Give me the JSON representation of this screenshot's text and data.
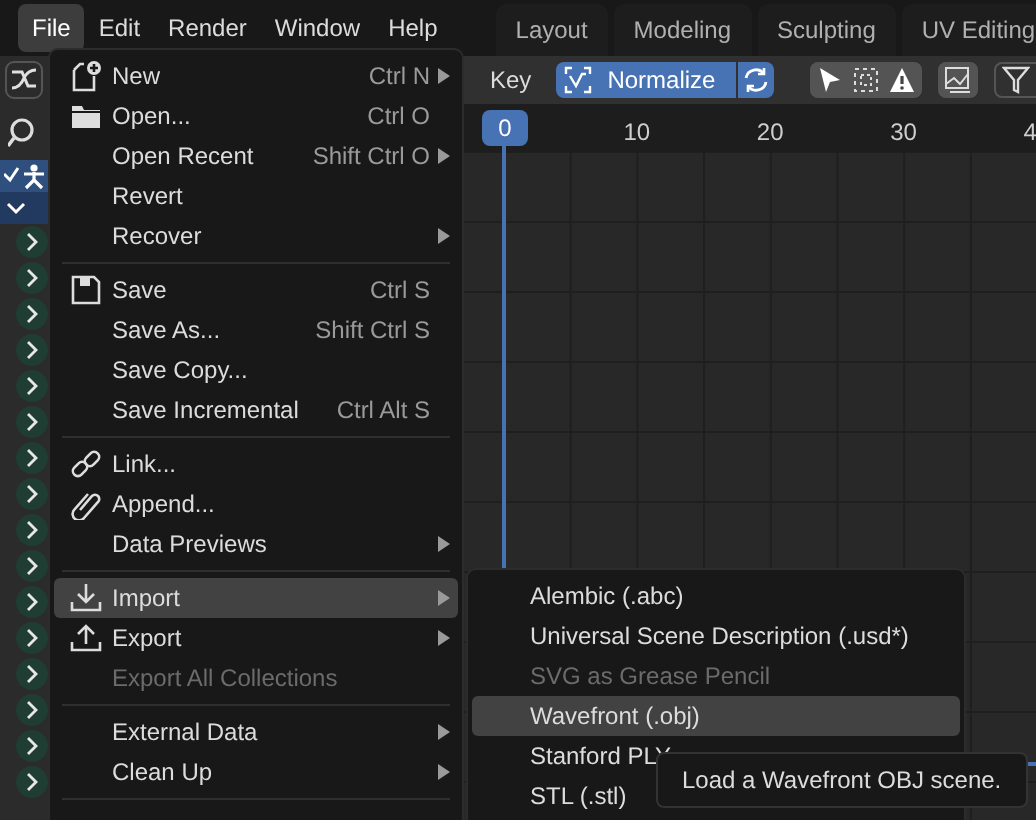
{
  "menubar": [
    {
      "label": "File",
      "selected": true
    },
    {
      "label": "Edit",
      "selected": false
    },
    {
      "label": "Render",
      "selected": false
    },
    {
      "label": "Window",
      "selected": false
    },
    {
      "label": "Help",
      "selected": false
    }
  ],
  "workspaces": [
    "Layout",
    "Modeling",
    "Sculpting",
    "UV Editing"
  ],
  "timeline": {
    "header_label": "Key",
    "normalize": {
      "label": "Normalize",
      "on": true
    },
    "current_frame": "0",
    "ticks": [
      "10",
      "20",
      "30",
      "4"
    ]
  },
  "file_menu": [
    {
      "kind": "item",
      "label": "New",
      "shortcut": "Ctrl N",
      "submenu": true,
      "disabled": false,
      "selected": false
    },
    {
      "kind": "item",
      "label": "Open...",
      "shortcut": "Ctrl O",
      "submenu": false,
      "disabled": false,
      "selected": false
    },
    {
      "kind": "item",
      "label": "Open Recent",
      "shortcut": "Shift Ctrl O",
      "submenu": true,
      "disabled": false,
      "selected": false
    },
    {
      "kind": "item",
      "label": "Revert",
      "submenu": false,
      "disabled": false,
      "selected": false
    },
    {
      "kind": "item",
      "label": "Recover",
      "submenu": true,
      "disabled": false,
      "selected": false
    },
    {
      "kind": "separator"
    },
    {
      "kind": "item",
      "label": "Save",
      "shortcut": "Ctrl S",
      "submenu": false,
      "disabled": false,
      "selected": false
    },
    {
      "kind": "item",
      "label": "Save As...",
      "shortcut": "Shift Ctrl S",
      "submenu": false,
      "disabled": false,
      "selected": false
    },
    {
      "kind": "item",
      "label": "Save Copy...",
      "submenu": false,
      "disabled": false,
      "selected": false
    },
    {
      "kind": "item",
      "label": "Save Incremental",
      "shortcut": "Ctrl Alt S",
      "submenu": false,
      "disabled": false,
      "selected": false
    },
    {
      "kind": "separator"
    },
    {
      "kind": "item",
      "label": "Link...",
      "submenu": false,
      "disabled": false,
      "selected": false
    },
    {
      "kind": "item",
      "label": "Append...",
      "submenu": false,
      "disabled": false,
      "selected": false
    },
    {
      "kind": "item",
      "label": "Data Previews",
      "submenu": true,
      "disabled": false,
      "selected": false
    },
    {
      "kind": "separator"
    },
    {
      "kind": "item",
      "label": "Import",
      "submenu": true,
      "disabled": false,
      "selected": true
    },
    {
      "kind": "item",
      "label": "Export",
      "submenu": true,
      "disabled": false,
      "selected": false
    },
    {
      "kind": "item",
      "label": "Export All Collections",
      "submenu": false,
      "disabled": true,
      "selected": false
    },
    {
      "kind": "separator"
    },
    {
      "kind": "item",
      "label": "External Data",
      "submenu": true,
      "disabled": false,
      "selected": false
    },
    {
      "kind": "item",
      "label": "Clean Up",
      "submenu": true,
      "disabled": false,
      "selected": false
    },
    {
      "kind": "separator"
    }
  ],
  "import_menu": [
    {
      "label": "Alembic (.abc)",
      "disabled": false,
      "selected": false
    },
    {
      "label": "Universal Scene Description (.usd*)",
      "disabled": false,
      "selected": false
    },
    {
      "label": "SVG as Grease Pencil",
      "disabled": true,
      "selected": false
    },
    {
      "label": "Wavefront (.obj)",
      "disabled": false,
      "selected": true
    },
    {
      "label": "Stanford PLY",
      "disabled": false,
      "selected": false
    },
    {
      "label": "STL (.stl)",
      "disabled": false,
      "selected": false
    }
  ],
  "tooltip": "Load a Wavefront OBJ scene."
}
